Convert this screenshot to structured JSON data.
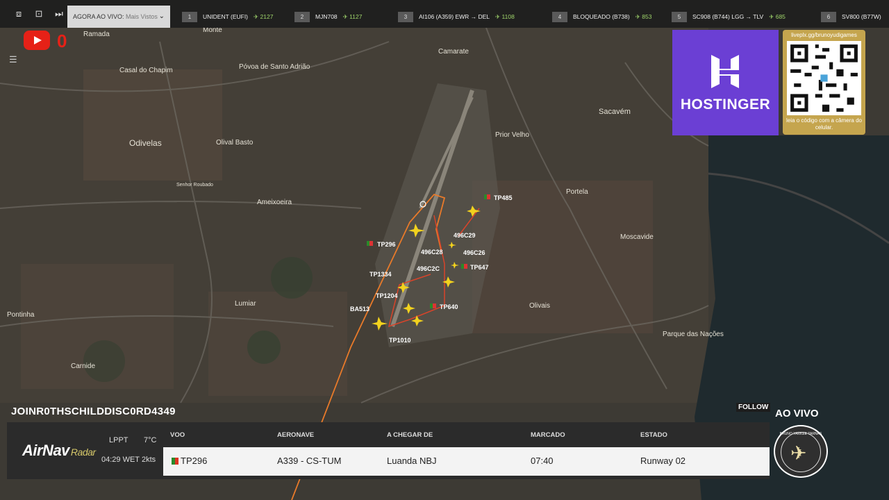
{
  "topbar": {
    "mode_label": "AGORA AO VIVO:",
    "mode_value": "Mais Vistos",
    "flights": [
      {
        "rank": "1",
        "flight": "UNIDENT (EUFI)",
        "count": "2127"
      },
      {
        "rank": "2",
        "flight": "MJN708",
        "count": "1127"
      },
      {
        "rank": "3",
        "flight": "AI106 (A359)  EWR → DEL",
        "count": "1108"
      },
      {
        "rank": "4",
        "flight": "BLOQUEADO (B738)",
        "count": "853"
      },
      {
        "rank": "5",
        "flight": "SC908 (B744)  LGG → TLV",
        "count": "685"
      },
      {
        "rank": "6",
        "flight": "SV800 (B77W)",
        "count": ""
      }
    ]
  },
  "youtube": {
    "count": "0"
  },
  "map": {
    "places": [
      "Ramada",
      "Monte",
      "Casal do Chapim",
      "Póvoa de Santo Adrião",
      "Camarate",
      "Odivelas",
      "Olival Basto",
      "Sacavém",
      "Prior Velho",
      "Ameixoeira",
      "Portela",
      "Moscavide",
      "Lumiar",
      "Olivais",
      "Pontinha",
      "Carnide",
      "Parque das Nações",
      "Senhor Roubado"
    ],
    "aircraft_labels": [
      "TP485",
      "TP296",
      "496C29",
      "496C28",
      "496C26",
      "496C2C",
      "TP647",
      "TP1334",
      "TP1204",
      "BA513",
      "TP640",
      "TP1010"
    ]
  },
  "sponsor": {
    "name": "HOSTINGER",
    "qr_url": "liveplx.gg/brunoyudigames",
    "qr_caption": "leia o código com a câmera do celular."
  },
  "bottom": {
    "username": "JOINR0THSCHILDDISC0RD4349",
    "follow": "FOLLOW",
    "ao_vivo": "AO VIVO",
    "brand": "AirNav",
    "brand_sub": "Radar",
    "airport": "LPPT",
    "temp": "7°C",
    "time": "04:29 WET",
    "wind": "2kts",
    "headers": {
      "voo": "VOO",
      "aeronave": "AERONAVE",
      "chegar": "A CHEGAR DE",
      "marcado": "MARCADO",
      "estado": "ESTADO"
    },
    "row": {
      "voo": "TP296",
      "aeronave": "A339 - CS-TUM",
      "chegar": "Luanda NBJ",
      "marcado": "07:40",
      "estado": "Runway 02"
    },
    "badge_text": "BRUNO YARKEE TARNAS"
  }
}
